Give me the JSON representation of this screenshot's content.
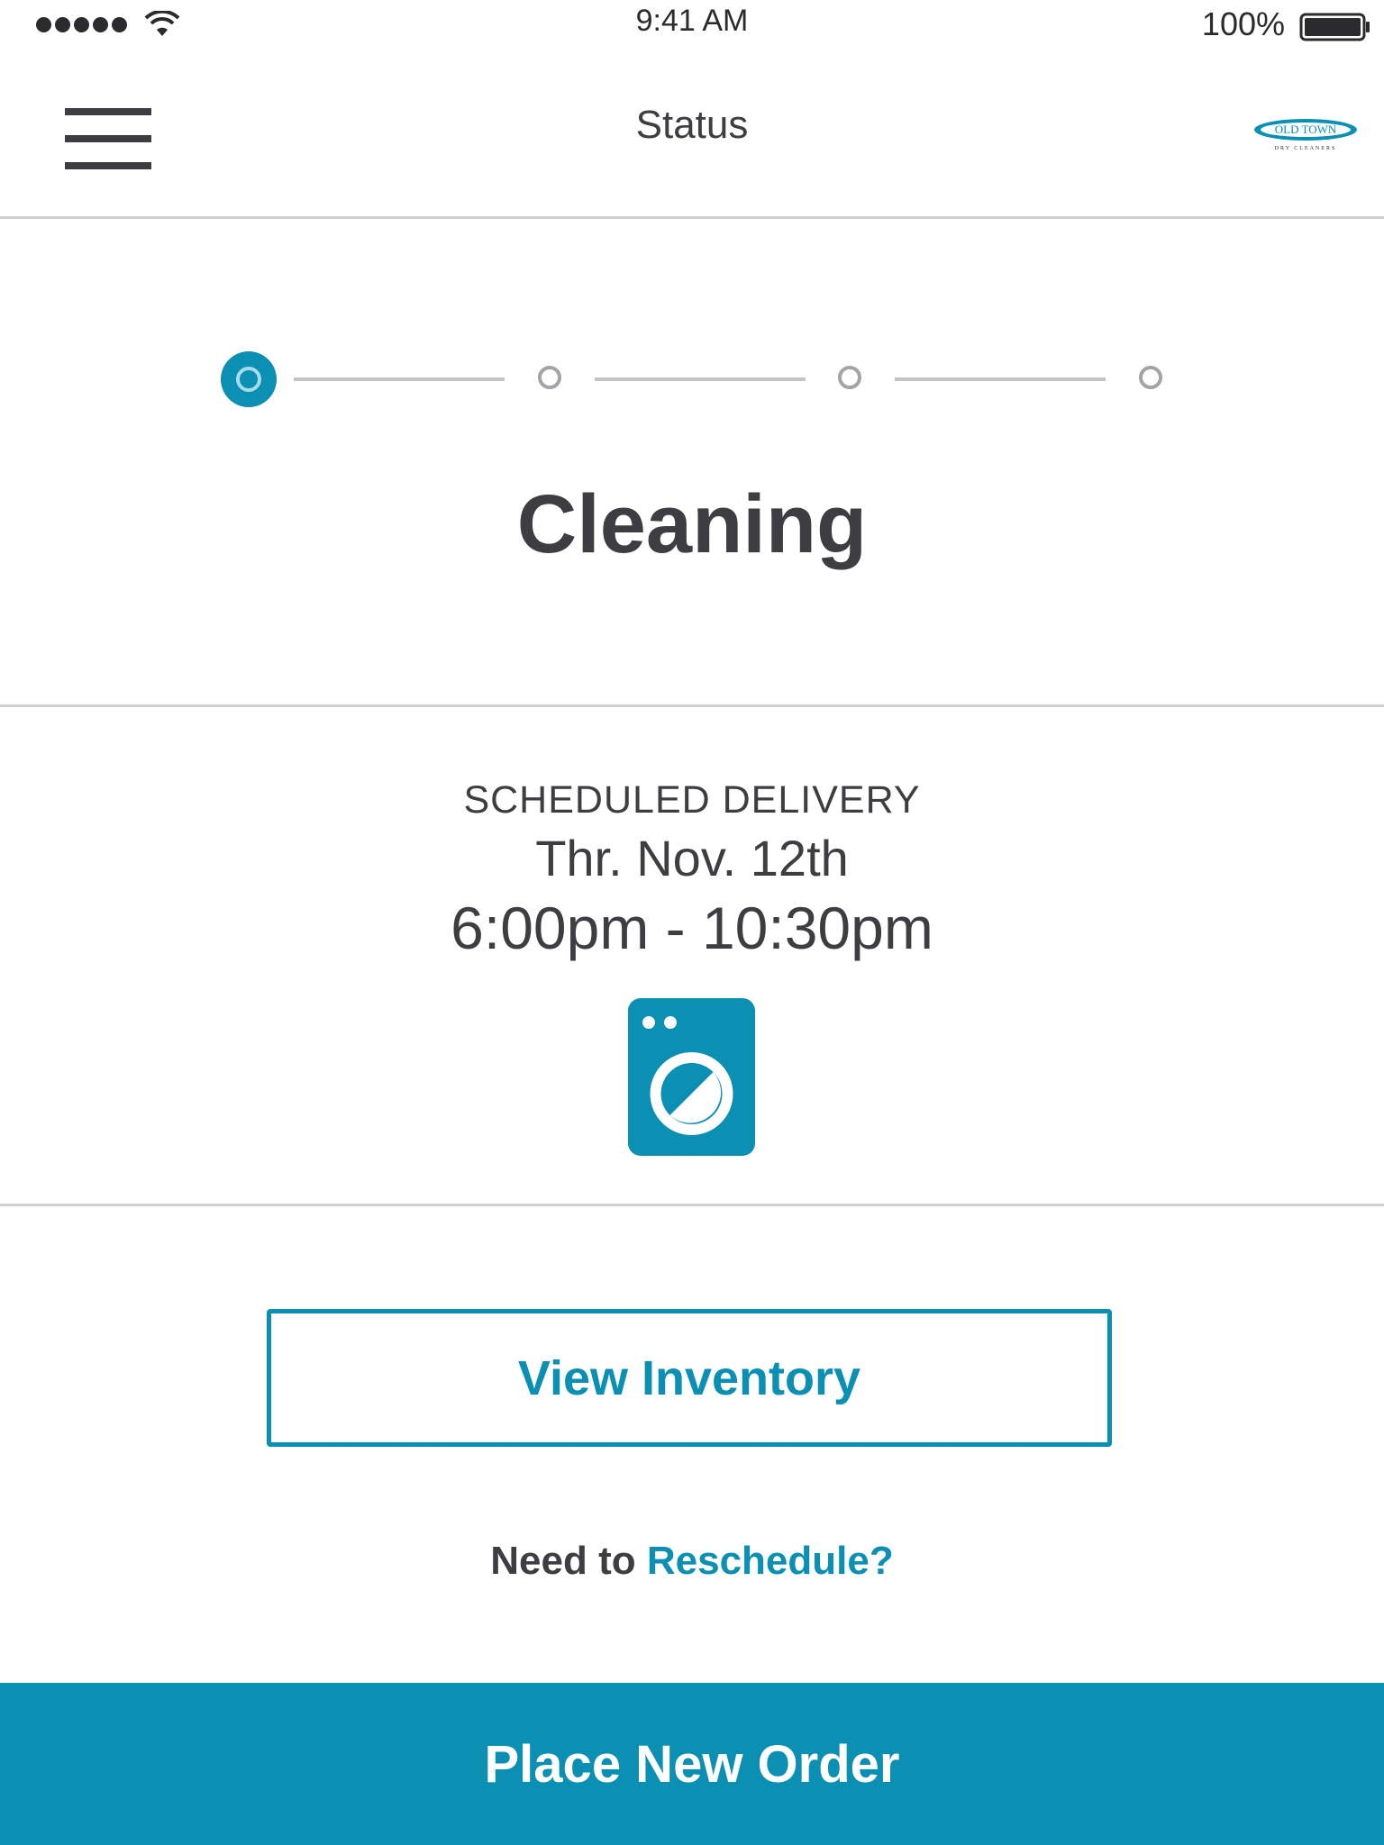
{
  "status_bar": {
    "time": "9:41 AM",
    "battery": "100%"
  },
  "nav": {
    "title": "Status",
    "logo_top": "OLD TOWN",
    "logo_bottom": "DRY CLEANERS"
  },
  "progress": {
    "current_step": 1,
    "total_steps": 4,
    "status": "Cleaning"
  },
  "delivery": {
    "label": "SCHEDULED DELIVERY",
    "date": "Thr. Nov. 12th",
    "window": "6:00pm - 10:30pm"
  },
  "actions": {
    "view_inventory": "View Inventory",
    "reschedule_prefix": "Need to",
    "reschedule_link": "Reschedule?",
    "place_order": "Place New Order"
  },
  "icons": {
    "menu": "hamburger-menu-icon",
    "washer": "washing-machine-icon",
    "wifi": "wifi-icon",
    "battery": "battery-icon"
  },
  "colors": {
    "accent": "#0b8fb3",
    "text": "#3d3d42",
    "divider": "#cfcfd1"
  }
}
